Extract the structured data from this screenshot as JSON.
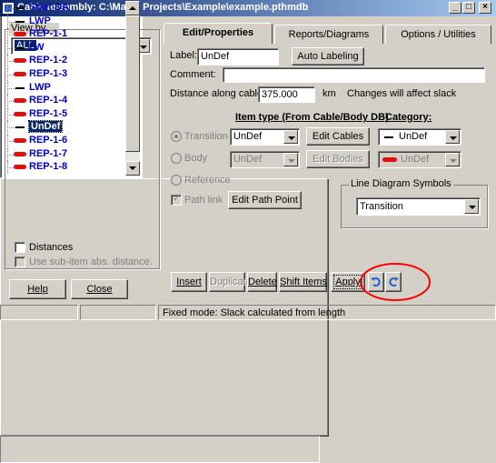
{
  "window": {
    "title": "Cable assembly: C:\\Makai Projects\\Example\\example.pthmdb",
    "minimize_label": "_",
    "maximize_label": "□",
    "close_label": "×"
  },
  "left_panel": {
    "view_by_label": "View by ...",
    "view_by_value": "ALL",
    "tree_items": [
      {
        "label": "Start DA",
        "glyph": "black"
      },
      {
        "label": "LWP",
        "glyph": "black"
      },
      {
        "label": "REP-1-1",
        "glyph": "red"
      },
      {
        "label": "LW",
        "glyph": "black"
      },
      {
        "label": "REP-1-2",
        "glyph": "red"
      },
      {
        "label": "REP-1-3",
        "glyph": "red"
      },
      {
        "label": "LWP",
        "glyph": "black"
      },
      {
        "label": "REP-1-4",
        "glyph": "red"
      },
      {
        "label": "REP-1-5",
        "glyph": "red"
      },
      {
        "label": "UnDef",
        "glyph": "black"
      },
      {
        "label": "REP-1-6",
        "glyph": "red"
      },
      {
        "label": "REP-1-7",
        "glyph": "red"
      },
      {
        "label": "REP-1-8",
        "glyph": "red"
      }
    ],
    "selected_index": 9,
    "distances_label": "Distances",
    "use_subitem_label": "Use sub-item abs. distance.",
    "help_label": "Help",
    "close_label": "Close"
  },
  "tabs": [
    {
      "label": "Edit/Properties",
      "active": true
    },
    {
      "label": "Reports/Diagrams",
      "active": false
    },
    {
      "label": "Options / Utilities",
      "active": false
    }
  ],
  "edit": {
    "label_caption": "Label:",
    "label_value": "UnDef",
    "auto_labeling_label": "Auto Labeling",
    "comment_caption": "Comment:",
    "comment_value": "",
    "distance_caption": "Distance along cable:",
    "distance_value": "375.000",
    "distance_unit": "km",
    "distance_note": "Changes will affect slack",
    "item_type_header": "Item type (From Cable/Body DB)",
    "category_header": "Category:",
    "transition_label": "Transition",
    "transition_value": "UnDef",
    "edit_cables_label": "Edit Cables",
    "transition_category_value": "UnDef",
    "body_label": "Body",
    "body_value": "UnDef",
    "edit_bodies_label": "Edit Bodies",
    "body_category_value": "UnDef",
    "reference_label": "Reference",
    "path_link_label": "Path link",
    "edit_path_point_label": "Edit Path Point",
    "line_diagram_label": "Line Diagram Symbols",
    "line_diagram_value": "Transition"
  },
  "action_bar": {
    "insert_label": "Insert",
    "duplicate_label": "Duplicate",
    "delete_label": "Delete",
    "shift_items_label": "Shift Items",
    "apply_label": "Apply"
  },
  "status": {
    "cell1": "",
    "cell2": "",
    "cell3": "Fixed mode: Slack calculated from length"
  },
  "colors": {
    "accent": "#0a246a",
    "tree_text": "#0000cc",
    "red_glyph": "#e01010",
    "highlight_circle": "#ff0000",
    "undo_blue": "#1e5fd8"
  }
}
